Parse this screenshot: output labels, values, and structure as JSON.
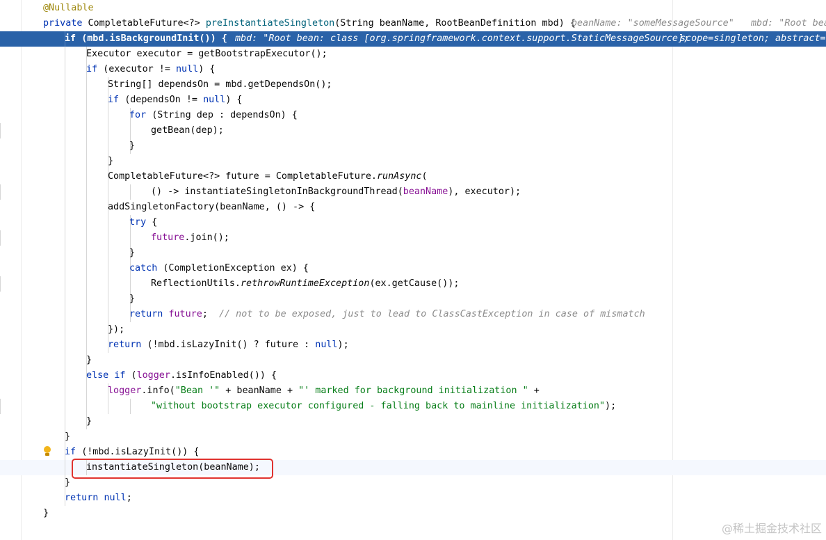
{
  "editor": {
    "lines": [
      {
        "tokens": [
          {
            "t": "@Nullable",
            "c": "ann"
          }
        ]
      },
      {
        "tokens": [
          {
            "t": "private ",
            "c": "kw"
          },
          {
            "t": "CompletableFuture<?> ",
            "c": "plain"
          },
          {
            "t": "preInstantiateSingleton",
            "c": "method"
          },
          {
            "t": "(String beanName, RootBeanDefinition mbd) {",
            "c": "plain"
          }
        ],
        "hints": [
          {
            "text": "beanName: \"someMessageSource\""
          },
          {
            "text": "mbd: \"Root bea"
          }
        ]
      },
      {
        "tokens": [
          {
            "t": "if ",
            "c": "kw"
          },
          {
            "t": "(mbd.isBackgroundInit()) {",
            "c": "plain"
          }
        ],
        "hints": [
          {
            "text": "mbd: \"Root bean: class [org.springframework.context.support.StaticMessageSource];"
          },
          {
            "text": "scope=singleton; abstract=f"
          }
        ]
      },
      {
        "tokens": [
          {
            "t": "Executor executor = getBootstrapExecutor();",
            "c": "plain"
          }
        ]
      },
      {
        "tokens": [
          {
            "t": "if ",
            "c": "kw"
          },
          {
            "t": "(executor != ",
            "c": "plain"
          },
          {
            "t": "null",
            "c": "kw"
          },
          {
            "t": ") {",
            "c": "plain"
          }
        ]
      },
      {
        "tokens": [
          {
            "t": "String[] dependsOn = mbd.getDependsOn();",
            "c": "plain"
          }
        ]
      },
      {
        "tokens": [
          {
            "t": "if ",
            "c": "kw"
          },
          {
            "t": "(dependsOn != ",
            "c": "plain"
          },
          {
            "t": "null",
            "c": "kw"
          },
          {
            "t": ") {",
            "c": "plain"
          }
        ]
      },
      {
        "tokens": [
          {
            "t": "for ",
            "c": "kw"
          },
          {
            "t": "(String dep : dependsOn) {",
            "c": "plain"
          }
        ]
      },
      {
        "tokens": [
          {
            "t": "getBean(dep);",
            "c": "plain"
          }
        ]
      },
      {
        "tokens": [
          {
            "t": "}",
            "c": "plain"
          }
        ]
      },
      {
        "tokens": [
          {
            "t": "}",
            "c": "plain"
          }
        ]
      },
      {
        "tokens": [
          {
            "t": "CompletableFuture<?> future = CompletableFuture.",
            "c": "plain"
          },
          {
            "t": "runAsync",
            "c": "static"
          },
          {
            "t": "(",
            "c": "plain"
          }
        ]
      },
      {
        "tokens": [
          {
            "t": "() -> instantiateSingletonInBackgroundThread(",
            "c": "plain"
          },
          {
            "t": "beanName",
            "c": "param"
          },
          {
            "t": "), executor);",
            "c": "plain"
          }
        ]
      },
      {
        "tokens": [
          {
            "t": "addSingletonFactory(beanName, () -> {",
            "c": "plain"
          }
        ]
      },
      {
        "tokens": [
          {
            "t": "try ",
            "c": "kw"
          },
          {
            "t": "{",
            "c": "plain"
          }
        ]
      },
      {
        "tokens": [
          {
            "t": "future",
            "c": "field"
          },
          {
            "t": ".join();",
            "c": "plain"
          }
        ]
      },
      {
        "tokens": [
          {
            "t": "}",
            "c": "plain"
          }
        ]
      },
      {
        "tokens": [
          {
            "t": "catch ",
            "c": "kw"
          },
          {
            "t": "(CompletionException ex) {",
            "c": "plain"
          }
        ]
      },
      {
        "tokens": [
          {
            "t": "ReflectionUtils.",
            "c": "plain"
          },
          {
            "t": "rethrowRuntimeException",
            "c": "static"
          },
          {
            "t": "(ex.getCause());",
            "c": "plain"
          }
        ]
      },
      {
        "tokens": [
          {
            "t": "}",
            "c": "plain"
          }
        ]
      },
      {
        "tokens": [
          {
            "t": "return ",
            "c": "kw"
          },
          {
            "t": "future",
            "c": "field"
          },
          {
            "t": ";  ",
            "c": "plain"
          },
          {
            "t": "// not to be exposed, just to lead to ClassCastException in case of mismatch",
            "c": "comment"
          }
        ]
      },
      {
        "tokens": [
          {
            "t": "});",
            "c": "plain"
          }
        ]
      },
      {
        "tokens": [
          {
            "t": "return ",
            "c": "kw"
          },
          {
            "t": "(!mbd.isLazyInit() ? future : ",
            "c": "plain"
          },
          {
            "t": "null",
            "c": "kw"
          },
          {
            "t": ");",
            "c": "plain"
          }
        ]
      },
      {
        "tokens": [
          {
            "t": "}",
            "c": "plain"
          }
        ]
      },
      {
        "tokens": [
          {
            "t": "else if ",
            "c": "kw"
          },
          {
            "t": "(",
            "c": "plain"
          },
          {
            "t": "logger",
            "c": "field"
          },
          {
            "t": ".isInfoEnabled()) {",
            "c": "plain"
          }
        ]
      },
      {
        "tokens": [
          {
            "t": "logger",
            "c": "field"
          },
          {
            "t": ".info(",
            "c": "plain"
          },
          {
            "t": "\"Bean '\"",
            "c": "str"
          },
          {
            "t": " + beanName + ",
            "c": "plain"
          },
          {
            "t": "\"' marked for background initialization \"",
            "c": "str"
          },
          {
            "t": " +",
            "c": "plain"
          }
        ]
      },
      {
        "tokens": [
          {
            "t": "\"without bootstrap executor configured - falling back to mainline initialization\"",
            "c": "str"
          },
          {
            "t": ");",
            "c": "plain"
          }
        ]
      },
      {
        "tokens": [
          {
            "t": "}",
            "c": "plain"
          }
        ]
      },
      {
        "tokens": [
          {
            "t": "}",
            "c": "plain"
          }
        ]
      },
      {
        "tokens": [
          {
            "t": "if ",
            "c": "kw"
          },
          {
            "t": "(!mbd.isLazyInit()) {",
            "c": "plain"
          }
        ]
      },
      {
        "tokens": [
          {
            "t": "instantiateSingleton(beanName);",
            "c": "plain"
          }
        ]
      },
      {
        "tokens": [
          {
            "t": "}",
            "c": "plain"
          }
        ]
      },
      {
        "tokens": [
          {
            "t": "return ",
            "c": "kw"
          },
          {
            "t": "null",
            "c": "kw"
          },
          {
            "t": ";",
            "c": "plain"
          }
        ]
      },
      {
        "tokens": [
          {
            "t": "}",
            "c": "plain"
          }
        ]
      }
    ],
    "execution_line": 2,
    "caret_line": 30,
    "highlighted_line": 30,
    "intention_bulb_line": 29
  },
  "watermark": "@稀土掘金技术社区",
  "colors": {
    "keyword": "#0033b3",
    "method_decl": "#00627a",
    "field": "#871094",
    "string": "#067d17",
    "annotation": "#9e880d",
    "comment": "#8c8c8c",
    "execution_highlight": "#2a62a8",
    "highlight_box": "#e0332f"
  }
}
